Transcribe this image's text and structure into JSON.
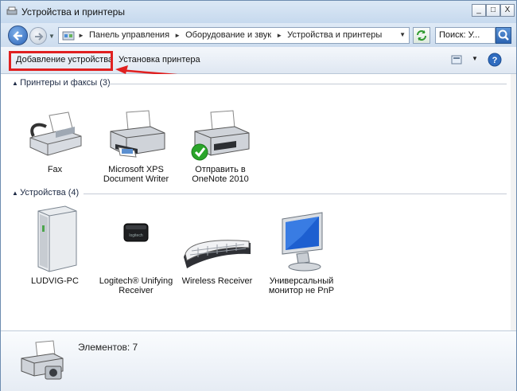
{
  "window": {
    "title": "Устройства и принтеры",
    "minimize": "_",
    "maximize": "□",
    "close": "X"
  },
  "address": {
    "breadcrumbs": [
      "Панель управления",
      "Оборудование и звук",
      "Устройства и принтеры"
    ],
    "separator": "►",
    "search_text": "Поиск: У..."
  },
  "toolbar": {
    "add_device": "Добавление устройства",
    "add_printer": "Установка принтера"
  },
  "groups": {
    "printers": {
      "header": "Принтеры и факсы (3)",
      "items": [
        {
          "label": "Fax",
          "icon": "fax-icon"
        },
        {
          "label": "Microsoft XPS Document Writer",
          "icon": "printer-icon"
        },
        {
          "label": "Отправить в OneNote 2010",
          "icon": "printer-default-icon"
        }
      ]
    },
    "devices": {
      "header": "Устройства (4)",
      "items": [
        {
          "label": "LUDVIG-PC",
          "icon": "computer-tower-icon"
        },
        {
          "label": "Logitech® Unifying Receiver",
          "icon": "usb-receiver-icon"
        },
        {
          "label": "Wireless Receiver",
          "icon": "keyboard-icon"
        },
        {
          "label": "Универсальный монитор не PnP",
          "icon": "monitor-icon"
        }
      ]
    }
  },
  "details": {
    "count_text": "Элементов: 7"
  },
  "colors": {
    "annotation_red": "#e02020",
    "default_check": "#2aa52a"
  }
}
